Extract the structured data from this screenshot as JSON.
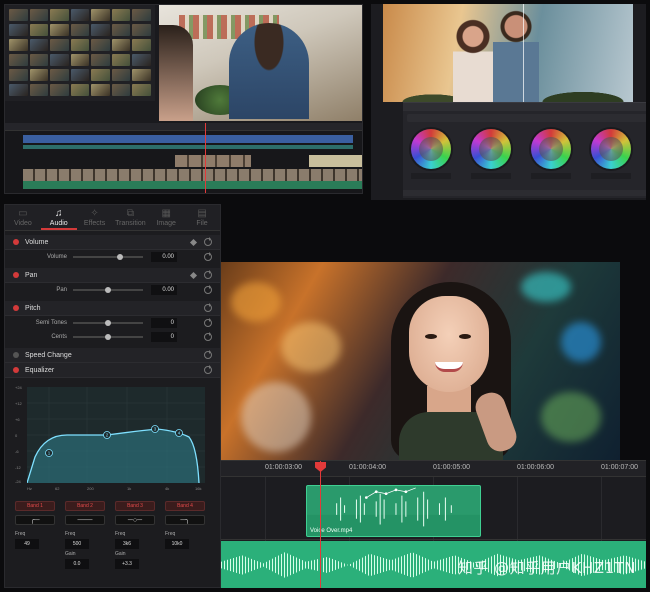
{
  "inspector": {
    "tabs": [
      {
        "label": "Video",
        "icon": "video-icon"
      },
      {
        "label": "Audio",
        "icon": "music-note-icon"
      },
      {
        "label": "Effects",
        "icon": "effects-icon"
      },
      {
        "label": "Transition",
        "icon": "transition-icon"
      },
      {
        "label": "Image",
        "icon": "image-icon"
      },
      {
        "label": "File",
        "icon": "file-icon"
      }
    ],
    "active_tab": "Audio",
    "volume": {
      "title": "Volume",
      "param": "Volume",
      "value": "0.00"
    },
    "pan": {
      "title": "Pan",
      "param": "Pan",
      "value": "0.00"
    },
    "pitch": {
      "title": "Pitch",
      "semitones_label": "Semi Tones",
      "semitones": "0",
      "cents_label": "Cents",
      "cents": "0"
    },
    "speed_change": {
      "title": "Speed Change"
    },
    "equalizer": {
      "title": "Equalizer",
      "y_ticks": [
        "+24",
        "+12",
        "+6",
        "0",
        "-6",
        "-12",
        "-24"
      ],
      "x_ticks": [
        "Hz",
        "62",
        "200",
        "1k",
        "4k",
        "16k"
      ],
      "bands": [
        {
          "label": "Band 1",
          "shape": "╭─",
          "freq_label": "Freq",
          "freq": "49"
        },
        {
          "label": "Band 2",
          "shape": "───",
          "freq_label": "Freq",
          "freq": "500",
          "gain_label": "Gain",
          "gain": "0.0"
        },
        {
          "label": "Band 3",
          "shape": "─○─",
          "freq_label": "Freq",
          "freq": "3k6",
          "gain_label": "Gain",
          "gain": "+3.3"
        },
        {
          "label": "Band 4",
          "shape": "─╮",
          "freq_label": "Freq",
          "freq": "10k0"
        }
      ]
    }
  },
  "timeline": {
    "timecodes": [
      "01:00:03:00",
      "01:00:04:00",
      "01:00:05:00",
      "01:00:06:00",
      "01:00:07:00"
    ],
    "voice_clip": "Voice Over.mp4"
  },
  "watermark": "知乎 @知乎用户KHZ1TN",
  "colors": {
    "accent": "#d33a3a",
    "clip_green": "#2a9a6c",
    "panel_bg": "#1c1c1f"
  }
}
